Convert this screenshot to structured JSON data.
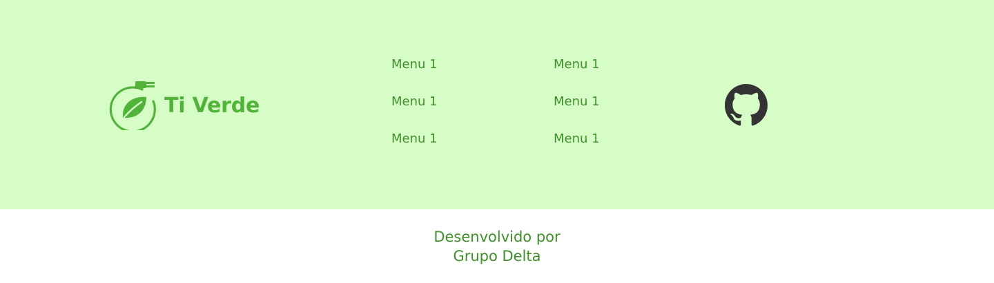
{
  "brand": {
    "name": "Ti Verde",
    "logo_icon": "leaf-plug-icon",
    "color": "#52b33a"
  },
  "menu": {
    "column_1": [
      "Menu 1",
      "Menu 1",
      "Menu 1"
    ],
    "column_2": [
      "Menu 1",
      "Menu 1",
      "Menu 1"
    ]
  },
  "social": {
    "github_icon": "github-icon"
  },
  "credit": {
    "line_1": "Desenvolvido por",
    "line_2": "Grupo Delta"
  },
  "colors": {
    "footer_background": "#d6fdc6",
    "text_green": "#3f8f2a",
    "github_dark": "#333333"
  }
}
